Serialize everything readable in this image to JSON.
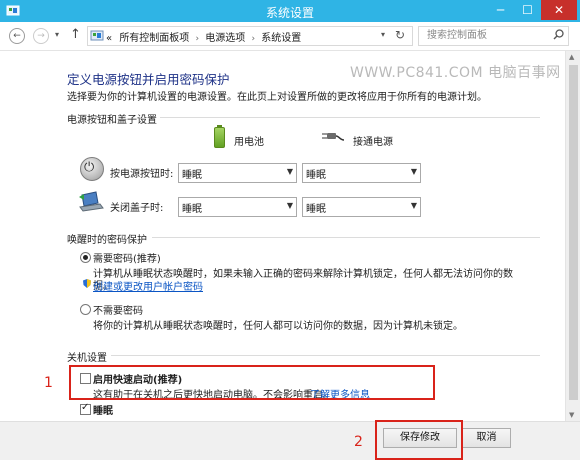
{
  "window": {
    "title": "系统设置",
    "minimize": "─",
    "maximize": "☐",
    "close": "✕"
  },
  "nav": {
    "back": "←",
    "forward": "→",
    "dropdown": "▾",
    "up": "↑"
  },
  "address": {
    "prefix": "«",
    "crumbs": [
      "所有控制面板项",
      "电源选项",
      "系统设置"
    ],
    "separator": "›",
    "dropdown": "▾",
    "refresh": "↻"
  },
  "search": {
    "placeholder": "搜索控制面板",
    "icon": "search-icon"
  },
  "watermark": "WWW.PC841.COM 电脑百事网",
  "page": {
    "title": "定义电源按钮并启用密码保护",
    "description": "选择要为你的计算机设置的电源设置。在此页上对设置所做的更改将应用于你所有的电源计划。",
    "power_section": {
      "heading": "电源按钮和盖子设置",
      "battery_label": "用电池",
      "plugged_label": "接通电源",
      "rows": [
        {
          "label": "按电源按钮时:",
          "battery": "睡眠",
          "plugged": "睡眠"
        },
        {
          "label": "关闭盖子时:",
          "battery": "睡眠",
          "plugged": "睡眠"
        }
      ]
    },
    "password_section": {
      "heading": "唤醒时的密码保护",
      "require_label": "需要密码(推荐)",
      "require_desc": "计算机从睡眠状态唤醒时，如果未输入正确的密码来解除计算机锁定，任何人都无法访问你的数",
      "require_desc2": "据。",
      "create_link": "创建或更改用户帐户密码",
      "norequire_label": "不需要密码",
      "norequire_desc": "将你的计算机从睡眠状态唤醒时，任何人都可以访问你的数据，因为计算机未锁定。",
      "selected": "require"
    },
    "shutdown_section": {
      "heading": "关机设置",
      "fast_startup_label": "启用快速启动(推荐)",
      "fast_startup_desc": "这有助于在关机之后更快地启动电脑。不会影响重启。",
      "learn_more": "了解更多信息",
      "fast_startup_checked": false,
      "sleep_label": "睡眠",
      "sleep_checked": true
    }
  },
  "annotations": {
    "box1_label": "1",
    "box2_label": "2",
    "color": "#d9231a"
  },
  "footer": {
    "save_label": "保存修改",
    "cancel_label": "取消"
  },
  "colors": {
    "titlebar": "#2fb4e5",
    "heading": "#1e3287",
    "link": "#0b55c4"
  }
}
